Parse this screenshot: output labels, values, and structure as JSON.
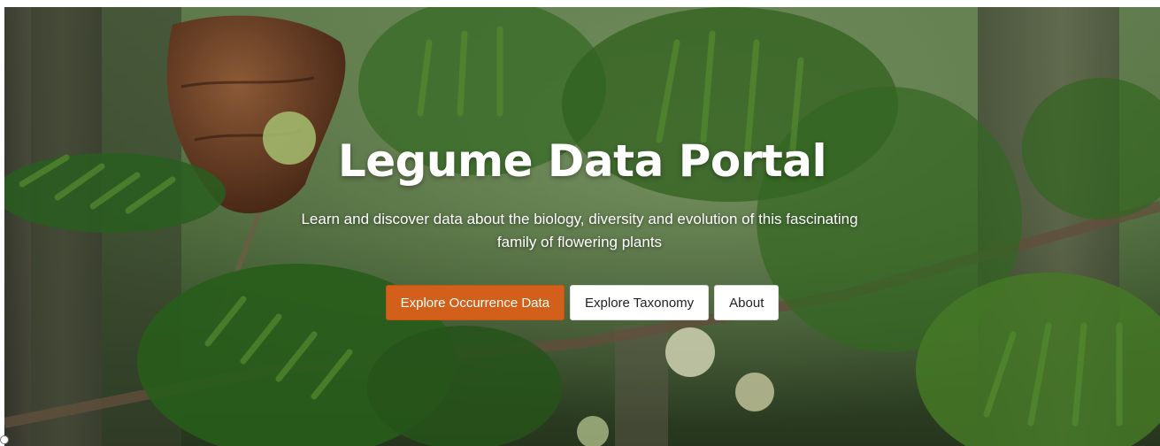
{
  "hero": {
    "title": "Legume Data Portal",
    "subtitle": "Learn and discover data about the biology, diversity and evolution of this fascinating family of flowering plants",
    "buttons": [
      {
        "label": "Explore Occurrence Data",
        "style": "primary",
        "color": "#d2601a"
      },
      {
        "label": "Explore Taxonomy",
        "style": "light"
      },
      {
        "label": "About",
        "style": "light"
      }
    ],
    "background_image": "photo-of-legume-tree-foliage"
  }
}
